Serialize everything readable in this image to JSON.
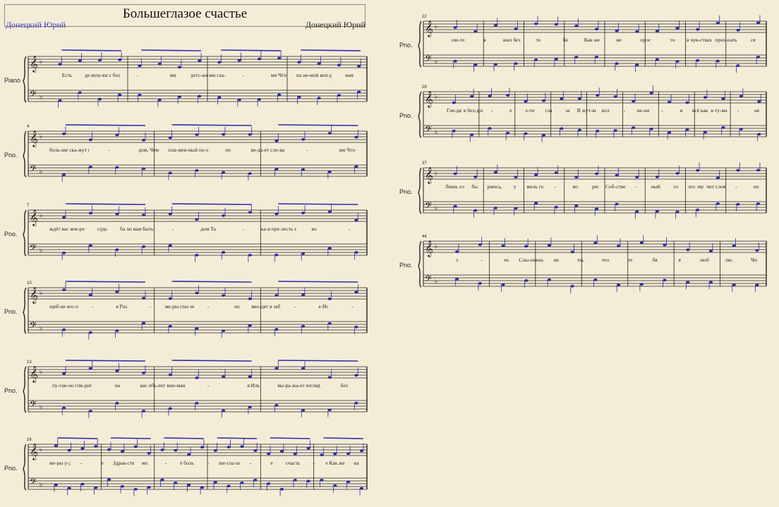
{
  "score": {
    "title": "Большеглазое счастье",
    "composer_left": "Донецкий Юрий",
    "composer_right": "Донецкий Юрий"
  },
  "systems": [
    {
      "instrument": "Piano",
      "measure": "",
      "lyrics": [
        "Есть",
        "де-вуш-ки с боль-ши",
        "-",
        "ми",
        "детс-ки-ми гла-за",
        "-",
        "ми Что",
        "на не-мой воп-рос",
        "вам"
      ]
    },
    {
      "instrument": "Pno.",
      "measure": "4",
      "lyrics": [
        "боль-ше ска-жут взгля",
        "-",
        "дом, Чем",
        "пла-мен-ный по-эт",
        "по",
        "ве-да-ет сло-ва",
        "-",
        "ми Что"
      ]
    },
    {
      "instrument": "Pno.",
      "measure": "7",
      "lyrics": [
        "ждёт вас впе-ре-ди",
        "судь",
        "ба ли вам быть ря",
        "-",
        "дом Та",
        "-",
        "ка-я пре-лесть есть",
        "во",
        "-"
      ]
    },
    {
      "instrument": "Pno.",
      "measure": "10",
      "lyrics": [
        "щиб-ке вос-при-five",
        "-",
        "я Раз",
        "-",
        "ме-ры глаз не-воль",
        "-",
        "но",
        "вво-дят в заб-луж-день",
        "-",
        "е Ис",
        "-"
      ]
    },
    {
      "instrument": "Pno.",
      "measure": "13",
      "lyrics": [
        "пу-ган-но гля-дит",
        "на",
        "вас объ-ект вни-мань",
        "-",
        "я Иль",
        "вы-ра-жа-ет взгляд",
        "без"
      ]
    },
    {
      "instrument": "Pno.",
      "measure": "16",
      "lyrics": [
        "ме-ры у-див-лень",
        "-",
        "е",
        "Здрав-ствуй",
        "мо",
        "-",
        "ё боль",
        "-",
        "ше-гла-зо",
        "-",
        "е",
        "счасть",
        "-",
        "е Как же",
        "на"
      ]
    },
    {
      "instrument": "Pno.",
      "measure": "22",
      "lyrics": [
        "све-те",
        "я",
        "жил без",
        "те",
        "бя",
        "Как же",
        "не",
        "прос",
        "то",
        "в чув-ствах",
        "приз-нать",
        "ся"
      ]
    },
    {
      "instrument": "Pno.",
      "measure": "28",
      "lyrics": [
        "Гля-дя",
        "в без-дон",
        "-",
        "е",
        "э-ти",
        "гла",
        "за",
        "В жут-ком",
        "вол",
        "-",
        "не-ни",
        "-",
        "и",
        "всё как",
        "в ту-ма",
        "-",
        "не"
      ]
    },
    {
      "instrument": "Pno.",
      "measure": "37",
      "lyrics": [
        "Лишь со",
        "бы",
        "раюсь,",
        "у",
        "жель го",
        "-",
        "во",
        "рю",
        "Соб-ствен",
        "-",
        "ный",
        "го",
        "лос зву",
        "чит слов",
        "-",
        "но"
      ]
    },
    {
      "instrument": "Pno.",
      "measure": "44",
      "lyrics": [
        "э",
        "-",
        "хо",
        "Слы-шишь",
        "ли",
        "ты,",
        "что",
        "те",
        "бя",
        "я",
        "люб",
        "лю.",
        "Чи"
      ]
    }
  ]
}
